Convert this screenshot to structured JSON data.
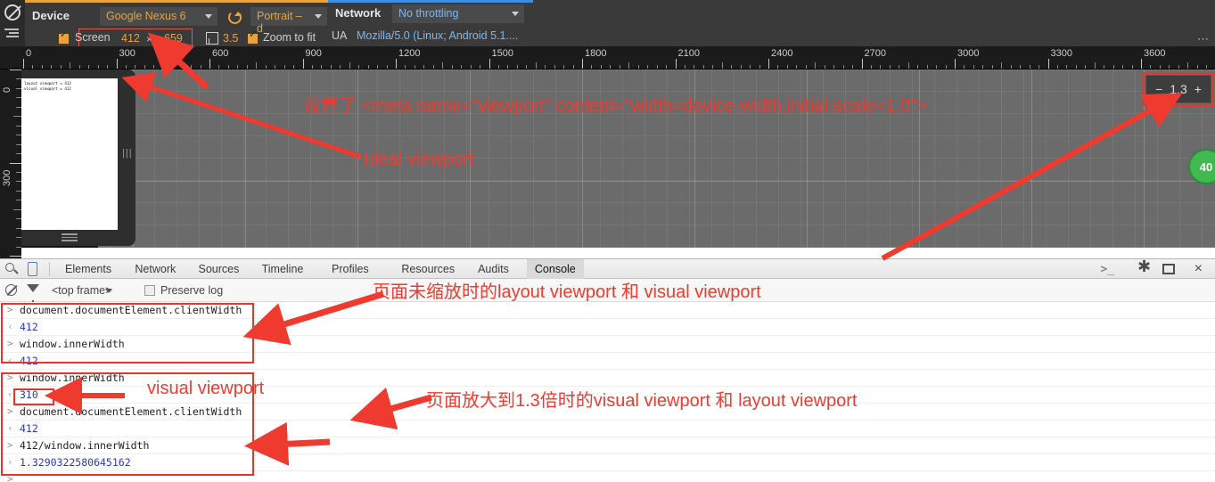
{
  "device_toolbar": {
    "device_label": "Device",
    "device_value": "Google Nexus 6",
    "orientation_value": "Portrait – d",
    "screen_label": "Screen",
    "screen_width": "412",
    "screen_times": "×",
    "screen_height": "659",
    "dpr_value": "3.5",
    "zoom_to_fit_label": "Zoom to fit",
    "network_label": "Network",
    "network_value": "No throttling",
    "ua_label": "UA",
    "ua_value": "Mozilla/5.0 (Linux; Android 5.1....",
    "overflow_dots": "⋯",
    "refresh_icon": "rotate-icon"
  },
  "ruler": {
    "h_labels": [
      "0",
      "300",
      "600",
      "900",
      "1200",
      "1500",
      "1800",
      "2100",
      "2400",
      "2700",
      "3000",
      "3300",
      "3600"
    ],
    "v_labels": [
      "0",
      "300"
    ],
    "spacing_px": 104.5
  },
  "viewport": {
    "page_text_line1": "layout viewport = 412",
    "page_text_line2": "visual viewport = 412",
    "zoom_minus": "−",
    "zoom_value": "1.3",
    "zoom_plus": "+",
    "badge_value": "40"
  },
  "devtools": {
    "tabs": [
      {
        "label": "Elements",
        "active": false
      },
      {
        "label": "Network",
        "active": false
      },
      {
        "label": "Sources",
        "active": false
      },
      {
        "label": "Timeline",
        "active": false
      },
      {
        "label": "Profiles",
        "active": false
      },
      {
        "label": "Resources",
        "active": false
      },
      {
        "label": "Audits",
        "active": false
      },
      {
        "label": "Console",
        "active": true
      }
    ],
    "search_icon": "search-icon",
    "device_icon": "mobile-device-icon",
    "console_prompt_icon": ">_",
    "gear_icon": "gear-icon",
    "dock_icon": "dock-icon",
    "close_icon": "×",
    "filter": {
      "clear_icon": "clear-console-icon",
      "filter_icon": "funnel-icon",
      "frame_value": "<top frame>",
      "preserve_log_label": "Preserve log",
      "preserve_log_checked": false
    },
    "console_entries": [
      {
        "kind": "input",
        "text": "document.documentElement.clientWidth"
      },
      {
        "kind": "output",
        "text": "412"
      },
      {
        "kind": "input",
        "text": "window.innerWidth"
      },
      {
        "kind": "output",
        "text": "412"
      },
      {
        "kind": "input",
        "text": "window.innerWidth"
      },
      {
        "kind": "output",
        "text": "310"
      },
      {
        "kind": "input",
        "text": "document.documentElement.clientWidth"
      },
      {
        "kind": "output",
        "text": "412"
      },
      {
        "kind": "input",
        "text": "412/window.innerWidth"
      },
      {
        "kind": "output",
        "text": "1.3290322580645162"
      },
      {
        "kind": "input",
        "text": ""
      }
    ]
  },
  "annotations": {
    "meta_viewport": "设置了 <meta name=\"viewport\" content=\"width=device-width,initial-scale=1.0\">",
    "ideal_viewport": "Ideal viewport",
    "unzoomed": "页面未缩放时的layout viewport 和 visual viewport",
    "visual_viewport": "visual viewport",
    "zoomed_1_3": "页面放大到1.3倍时的visual viewport 和 layout viewport",
    "color": "#ef3b2f"
  }
}
